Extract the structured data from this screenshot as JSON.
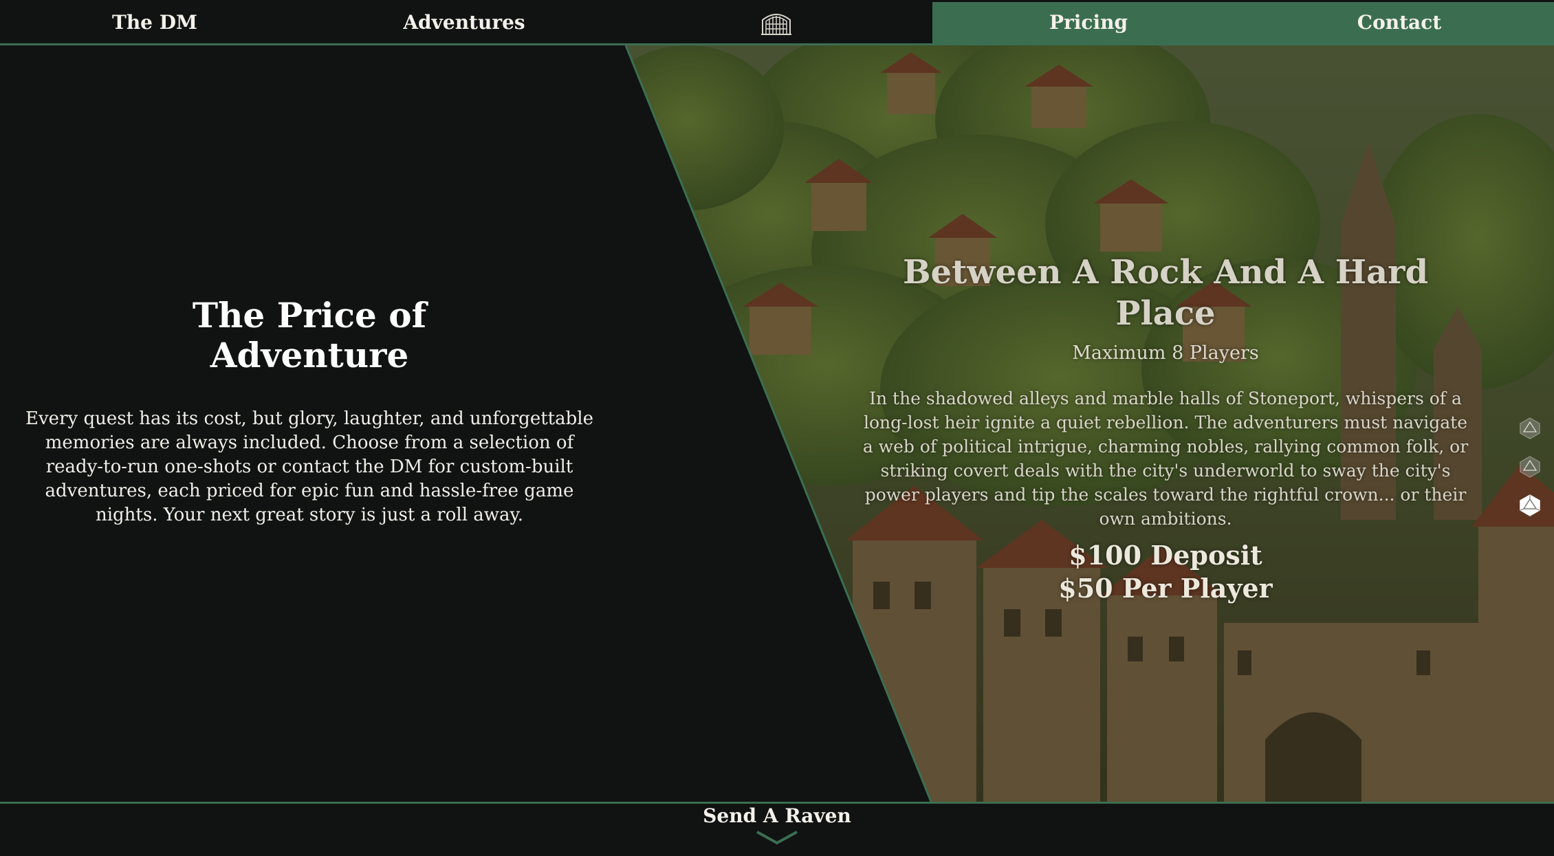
{
  "nav": {
    "items": [
      {
        "label": "The DM"
      },
      {
        "label": "Adventures"
      },
      {
        "label": "Pricing",
        "active": true
      },
      {
        "label": "Contact"
      }
    ],
    "logo_icon": "castle-gate-icon",
    "active_color": "#3b6e51"
  },
  "intro": {
    "title_line1": "The Price of",
    "title_line2": "Adventure",
    "body": "Every quest has its cost, but glory, laughter, and unforgettable memories are always included. Choose from a selection of ready-to-run one-shots or contact the DM for custom-built adventures, each priced for epic fun and hassle-free game nights. Your next great story is just a roll away."
  },
  "adventure": {
    "title": "Between A Rock And A Hard Place",
    "players": "Maximum 8 Players",
    "description": "In the shadowed alleys and marble halls of Stoneport, whispers of a long-lost heir ignite a quiet rebellion. The adventurers must navigate a web of political intrigue, charming nobles, rallying common folk, or striking covert deals with the city's underworld to sway the city's power players and tip the scales toward the rightful crown... or their own ambitions.",
    "deposit": "$100 Deposit",
    "per_player": "$50 Per Player"
  },
  "carousel": {
    "count": 3,
    "active_index": 2,
    "icon": "d20-die-icon"
  },
  "footer": {
    "cta": "Send A Raven",
    "icon": "chevron-down-icon"
  },
  "colors": {
    "background": "#111312",
    "accent": "#3b6e51",
    "text": "#f4f1ea"
  }
}
